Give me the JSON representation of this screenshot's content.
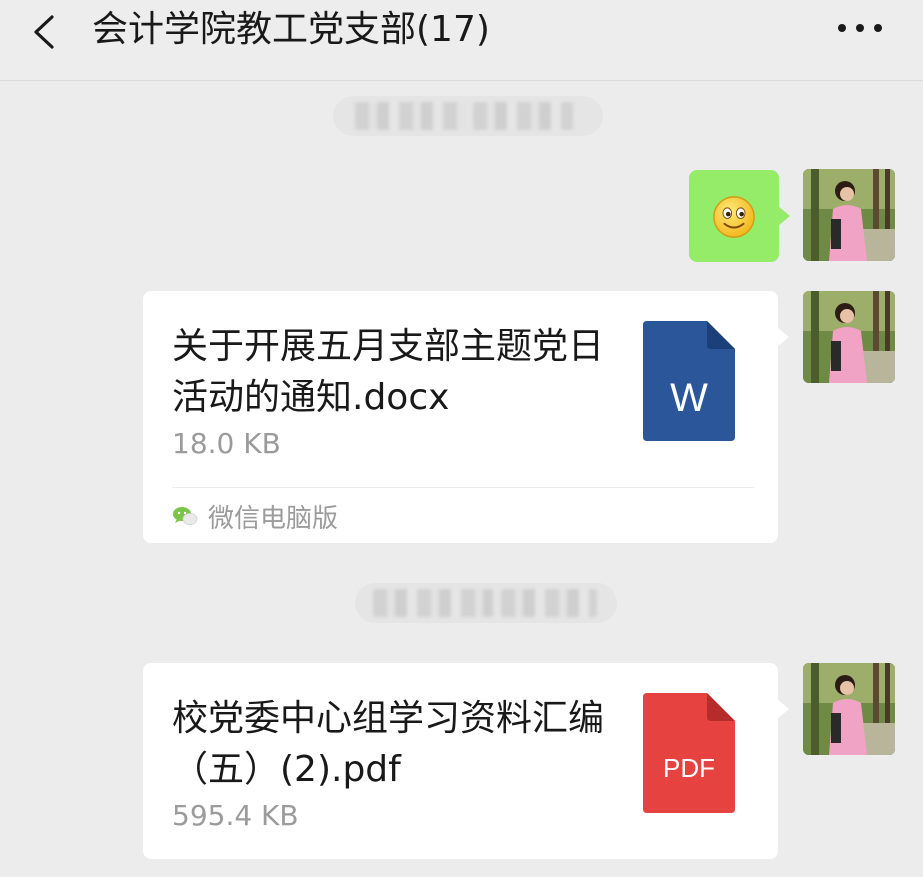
{
  "header": {
    "title": "会计学院教工党支部(17)",
    "back_icon": "back-chevron-icon",
    "more_icon": "more-dots-icon"
  },
  "messages": [
    {
      "type": "timestamp",
      "text": ""
    },
    {
      "type": "emoji",
      "icon": "smiley-emoji-icon",
      "sender": "self"
    },
    {
      "type": "file",
      "sender": "self",
      "file_name": "关于开展五月支部主题党日活动的通知.docx",
      "file_size": "18.0 KB",
      "file_icon": "word-file-icon",
      "icon_label": "W",
      "icon_color": "#2b579a",
      "source": "微信电脑版",
      "source_icon": "wechat-icon"
    },
    {
      "type": "timestamp",
      "text": ""
    },
    {
      "type": "file",
      "sender": "self",
      "file_name": "校党委中心组学习资料汇编（五）(2).pdf",
      "file_size": "595.4 KB",
      "file_icon": "pdf-file-icon",
      "icon_label": "PDF",
      "icon_color": "#e64340"
    }
  ],
  "colors": {
    "background": "#ececec",
    "self_bubble": "#95ec69",
    "card": "#ffffff",
    "secondary_text": "#9b9b9b"
  }
}
